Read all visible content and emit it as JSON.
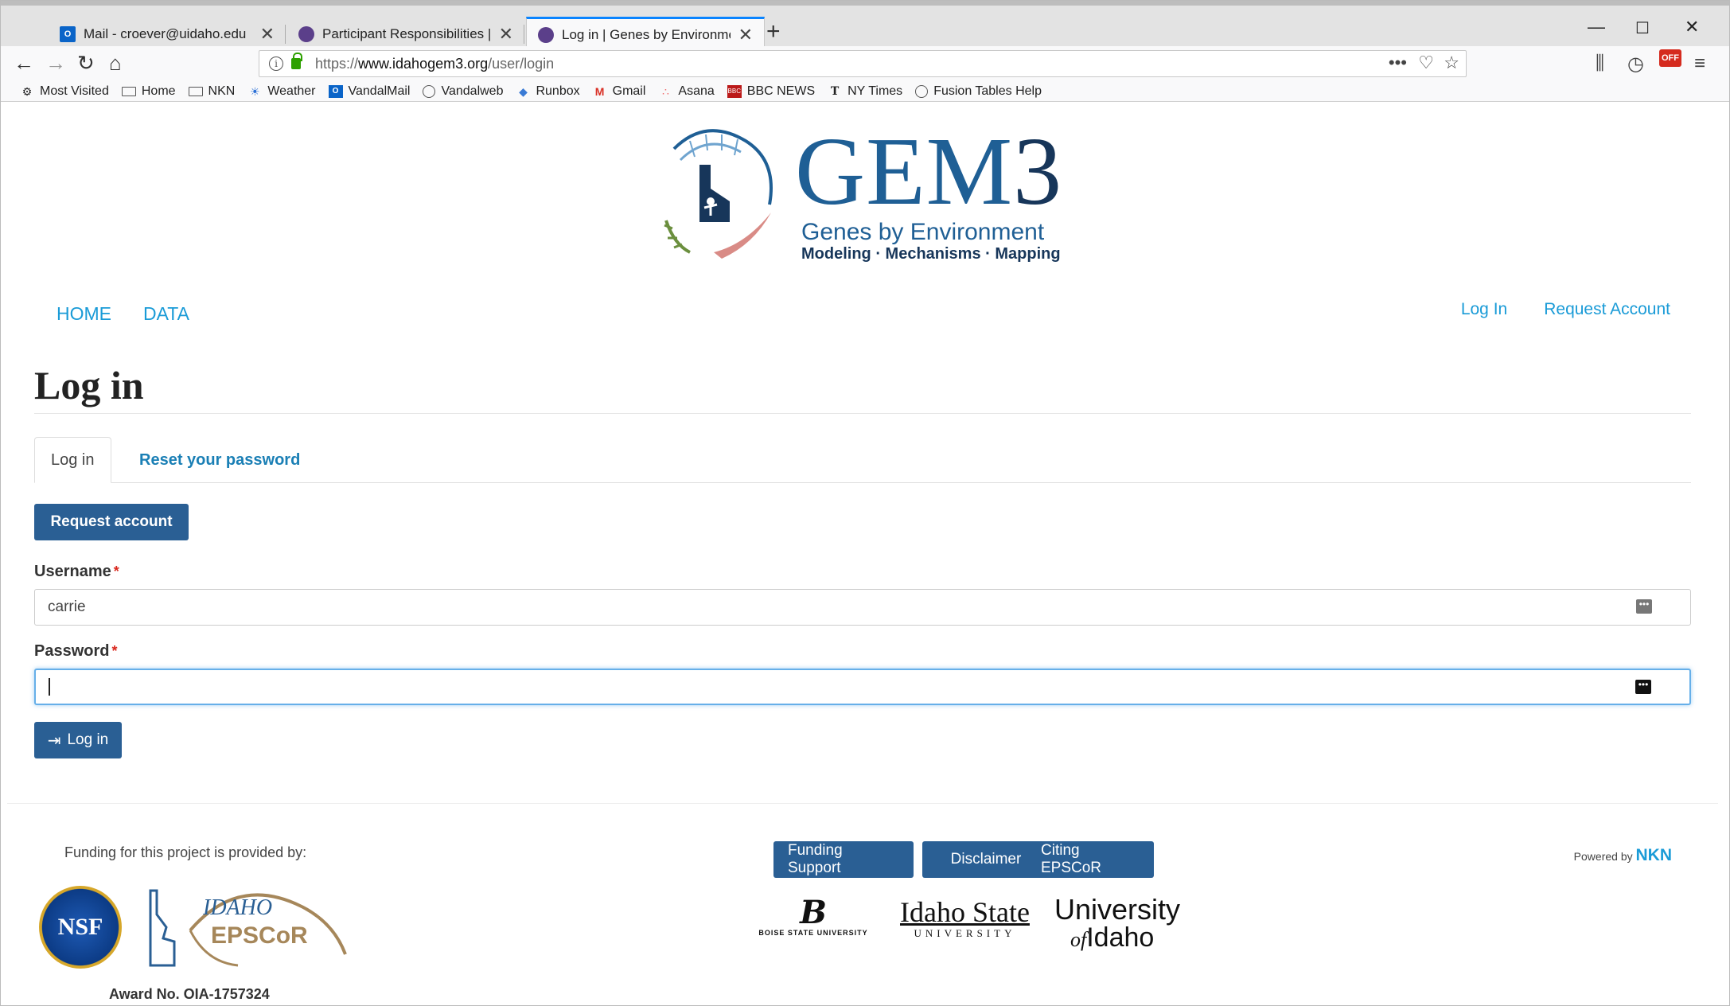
{
  "browser": {
    "tabs": [
      {
        "title": "Mail - croever@uidaho.edu",
        "favicon": "outlook-icon"
      },
      {
        "title": "Participant Responsibilities | Ge",
        "favicon": "gem3-icon"
      },
      {
        "title": "Log in | Genes by Environment",
        "favicon": "gem3-icon",
        "active": true
      }
    ],
    "url": {
      "scheme": "https://",
      "host": "www.idahogem3.org",
      "path": "/user/login"
    },
    "bookmarks": [
      {
        "label": "Most Visited",
        "icon": "gear-icon"
      },
      {
        "label": "Home",
        "icon": "folder-icon"
      },
      {
        "label": "NKN",
        "icon": "folder-icon"
      },
      {
        "label": "Weather",
        "icon": "weather-icon"
      },
      {
        "label": "VandalMail",
        "icon": "outlook-icon"
      },
      {
        "label": "Vandalweb",
        "icon": "globe-icon"
      },
      {
        "label": "Runbox",
        "icon": "runbox-icon"
      },
      {
        "label": "Gmail",
        "icon": "gmail-icon"
      },
      {
        "label": "Asana",
        "icon": "asana-icon"
      },
      {
        "label": "BBC NEWS",
        "icon": "bbc-icon"
      },
      {
        "label": "NY Times",
        "icon": "nytimes-icon"
      },
      {
        "label": "Fusion Tables Help",
        "icon": "globe-icon"
      }
    ],
    "extension_badge": "OFF"
  },
  "site": {
    "logo": {
      "title_main": "GEM",
      "title_three": "3",
      "subtitle": "Genes by Environment",
      "tagline": "Modeling · Mechanisms · Mapping"
    },
    "main_nav": [
      "HOME",
      "DATA"
    ],
    "user_nav": [
      "Log In",
      "Request Account"
    ]
  },
  "main": {
    "heading": "Log in",
    "tabs": [
      "Log in",
      "Reset your password"
    ],
    "request_account_label": "Request account",
    "username": {
      "label": "Username",
      "value": "carrie"
    },
    "password": {
      "label": "Password",
      "value": ""
    },
    "submit_label": "Log in"
  },
  "footer": {
    "funding_text": "Funding for this project is provided by:",
    "buttons": [
      "Funding Support",
      "Disclaimer",
      "Citing EPSCoR"
    ],
    "powered_by": "Powered by",
    "powered_by_brand": "NKN",
    "award": "Award No. OIA-1757324",
    "logos": {
      "nsf": "NSF",
      "epscor_top": "IDAHO",
      "epscor_bottom": "EPSCoR",
      "boise_mark": "B",
      "boise_text": "BOISE STATE UNIVERSITY",
      "isu_top": "Idaho State",
      "isu_bottom": "UNIVERSITY",
      "ui_top": "University",
      "ui_of": "of",
      "ui_bottom": "Idaho"
    }
  },
  "colors": {
    "brand_blue": "#1f5f95",
    "button_blue": "#2a5f94",
    "link_blue": "#1a9bd7",
    "required_red": "#d9261c"
  }
}
